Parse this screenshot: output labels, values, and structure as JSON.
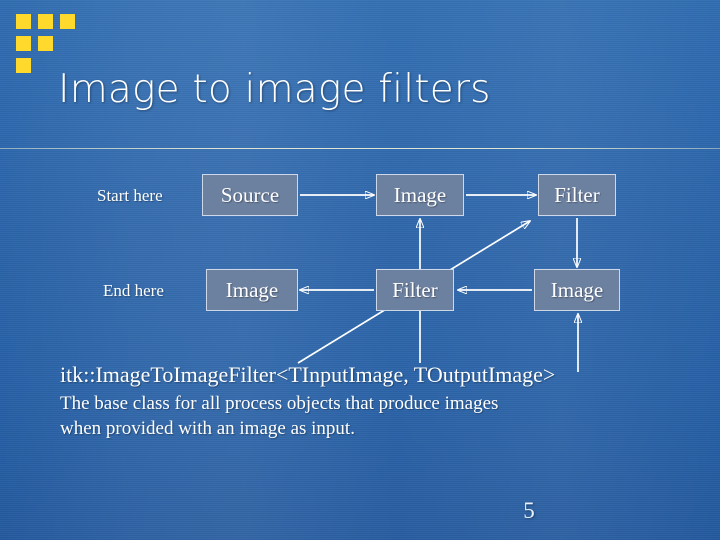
{
  "slide": {
    "title": "Image to image filters",
    "page_number": "5",
    "logo_name": "itk-squares-logo"
  },
  "diagram": {
    "start_label": "Start here",
    "end_label": "End here",
    "nodes": [
      {
        "id": "source",
        "label": "Source"
      },
      {
        "id": "image1",
        "label": "Image"
      },
      {
        "id": "filter1",
        "label": "Filter"
      },
      {
        "id": "image2",
        "label": "Image"
      },
      {
        "id": "filter2",
        "label": "Filter"
      },
      {
        "id": "image3",
        "label": "Image"
      }
    ]
  },
  "content": {
    "signature": "itk::ImageToImageFilter<TInputImage, TOutputImage>",
    "description_line1": "The base class for all process objects that produce images",
    "description_line2": "when provided with an image as input."
  },
  "colors": {
    "background_top": "#2f6cb0",
    "background_bottom": "#23599e",
    "node_fill": "#6c80a0",
    "node_border": "#cfd8e8",
    "accent_logo": "#ffd92b",
    "text": "#ffffff"
  }
}
